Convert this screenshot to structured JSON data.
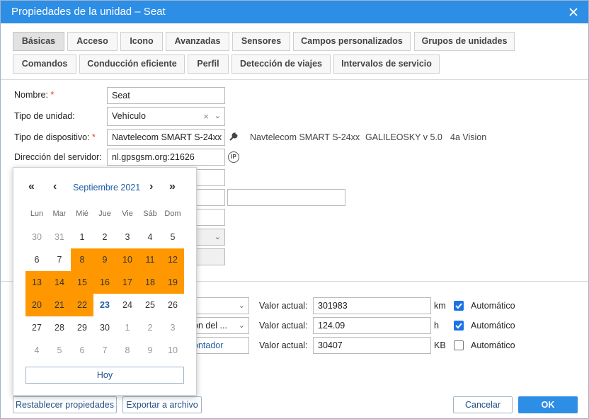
{
  "dialog": {
    "title": "Propiedades de la unidad – Seat"
  },
  "tabs": [
    {
      "label": "Básicas",
      "active": true
    },
    {
      "label": "Acceso"
    },
    {
      "label": "Icono"
    },
    {
      "label": "Avanzadas"
    },
    {
      "label": "Sensores"
    },
    {
      "label": "Campos personalizados"
    },
    {
      "label": "Grupos de unidades"
    },
    {
      "label": "Comandos"
    },
    {
      "label": "Conducción eficiente"
    },
    {
      "label": "Perfil"
    },
    {
      "label": "Detección de viajes"
    },
    {
      "label": "Intervalos de servicio"
    }
  ],
  "form": {
    "name_label": "Nombre:",
    "name_value": "Seat",
    "unit_type_label": "Tipo de unidad:",
    "unit_type_value": "Vehículo",
    "device_type_label": "Tipo de dispositivo:",
    "device_type_value": "Navtelecom SMART S-24xx",
    "device_suggestions": [
      "Navtelecom SMART S-24xx",
      "GALILEOSKY v 5.0",
      "4a Vision"
    ],
    "server_label": "Dirección del servidor:",
    "server_value": "nl.gpsgsm.org:21626",
    "required_mark": "*",
    "ip_icon_text": "IP",
    "clear_mark": "×",
    "dropdown_arrow": "⌄"
  },
  "counters": [
    {
      "select_value": "",
      "current_label": "Valor actual:",
      "value": "301983",
      "unit": "km",
      "auto_label": "Automático",
      "auto_checked": true
    },
    {
      "select_value": "ón del ...",
      "current_label": "Valor actual:",
      "value": "124.09",
      "unit": "h",
      "auto_label": "Automático",
      "auto_checked": true
    },
    {
      "select_value": "ontador",
      "current_label": "Valor actual:",
      "value": "30407",
      "unit": "KB",
      "auto_label": "Automático",
      "auto_checked": false
    }
  ],
  "calendar": {
    "month_label": "Septiembre 2021",
    "nav": {
      "prev_year": "«",
      "prev_month": "‹",
      "next_month": "›",
      "next_year": "»"
    },
    "weekdays": [
      "Lun",
      "Mar",
      "Mié",
      "Jue",
      "Vie",
      "Sáb",
      "Dom"
    ],
    "weeks": [
      [
        {
          "d": "30",
          "out": true
        },
        {
          "d": "31",
          "out": true
        },
        {
          "d": "1"
        },
        {
          "d": "2"
        },
        {
          "d": "3"
        },
        {
          "d": "4"
        },
        {
          "d": "5"
        }
      ],
      [
        {
          "d": "6"
        },
        {
          "d": "7"
        },
        {
          "d": "8",
          "sel": true
        },
        {
          "d": "9",
          "sel": true
        },
        {
          "d": "10",
          "sel": true
        },
        {
          "d": "11",
          "sel": true
        },
        {
          "d": "12",
          "sel": true
        }
      ],
      [
        {
          "d": "13",
          "sel": true
        },
        {
          "d": "14",
          "sel": true
        },
        {
          "d": "15",
          "sel": true
        },
        {
          "d": "16",
          "sel": true
        },
        {
          "d": "17",
          "sel": true
        },
        {
          "d": "18",
          "sel": true
        },
        {
          "d": "19",
          "sel": true
        }
      ],
      [
        {
          "d": "20",
          "sel": true
        },
        {
          "d": "21",
          "sel": true
        },
        {
          "d": "22",
          "sel": true
        },
        {
          "d": "23",
          "today": true
        },
        {
          "d": "24"
        },
        {
          "d": "25"
        },
        {
          "d": "26"
        }
      ],
      [
        {
          "d": "27"
        },
        {
          "d": "28"
        },
        {
          "d": "29"
        },
        {
          "d": "30"
        },
        {
          "d": "1",
          "out": true
        },
        {
          "d": "2",
          "out": true
        },
        {
          "d": "3",
          "out": true
        }
      ],
      [
        {
          "d": "4",
          "out": true
        },
        {
          "d": "5",
          "out": true
        },
        {
          "d": "6",
          "out": true
        },
        {
          "d": "7",
          "out": true
        },
        {
          "d": "8",
          "out": true
        },
        {
          "d": "9",
          "out": true
        },
        {
          "d": "10",
          "out": true
        }
      ]
    ],
    "today_button": "Hoy",
    "selected_color": "#ff9800"
  },
  "footer": {
    "reset_label": "Restablecer propiedades",
    "export_label": "Exportar a archivo",
    "cancel_label": "Cancelar",
    "ok_label": "OK"
  },
  "colors": {
    "titlebar": "#2d8ee6",
    "accent": "#1a73e8",
    "selection": "#ff9800"
  }
}
